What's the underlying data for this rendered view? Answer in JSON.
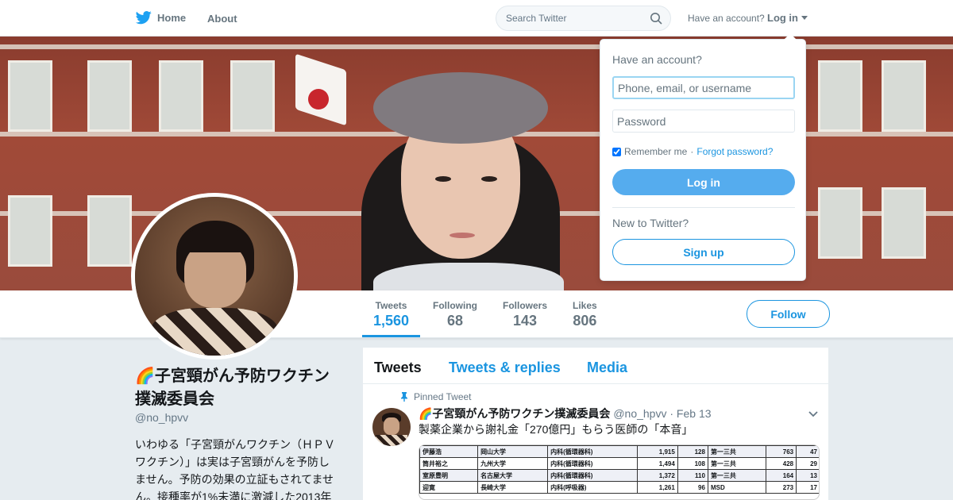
{
  "nav": {
    "home_label": "Home",
    "about_label": "About",
    "search_placeholder": "Search Twitter",
    "have_account": "Have an account?",
    "login_label": "Log in"
  },
  "login_panel": {
    "title": "Have an account?",
    "username_placeholder": "Phone, email, or username",
    "password_placeholder": "Password",
    "remember_label": "Remember me",
    "separator": "·",
    "forgot_label": "Forgot password?",
    "login_button": "Log in",
    "new_to_twitter": "New to Twitter?",
    "signup_button": "Sign up"
  },
  "stats": [
    {
      "label": "Tweets",
      "value": "1,560"
    },
    {
      "label": "Following",
      "value": "68"
    },
    {
      "label": "Followers",
      "value": "143"
    },
    {
      "label": "Likes",
      "value": "806"
    }
  ],
  "follow_button": "Follow",
  "profile": {
    "name": "🌈子宮頸がん予防ワクチン撲滅委員会",
    "handle": "@no_hpvv",
    "bio": "いわゆる「子宮頸がんワクチン（ＨＰＶワクチン）」は実は子宮頸がんを予防しません。予防の効果の立証もされてません。接種率が1%未満に激減した2013年"
  },
  "timeline": {
    "tabs": [
      "Tweets",
      "Tweets & replies",
      "Media"
    ],
    "pinned_label": "Pinned Tweet",
    "tweet": {
      "name": "🌈子宮頸がん予防ワクチン撲滅委員会",
      "handle": "@no_hpvv",
      "date": "· Feb 13",
      "text": "製薬企業から謝礼金「270億円」もらう医師の「本音」"
    },
    "table_rows": [
      [
        "伊藤浩",
        "岡山大学",
        "内科(循環器科)",
        "1,915",
        "128",
        "第一三共",
        "763",
        "47"
      ],
      [
        "筒井裕之",
        "九州大学",
        "内科(循環器科)",
        "1,494",
        "108",
        "第一三共",
        "428",
        "29"
      ],
      [
        "室原豊明",
        "名古屋大学",
        "内科(循環器科)",
        "1,372",
        "110",
        "第一三共",
        "164",
        "13"
      ],
      [
        "迎寛",
        "長崎大学",
        "内科(呼吸器)",
        "1,261",
        "96",
        "MSD",
        "273",
        "17"
      ]
    ]
  },
  "colors": {
    "accent": "#1b95e0",
    "button_fill": "#55acee",
    "page_bg": "#e6ecf0"
  }
}
